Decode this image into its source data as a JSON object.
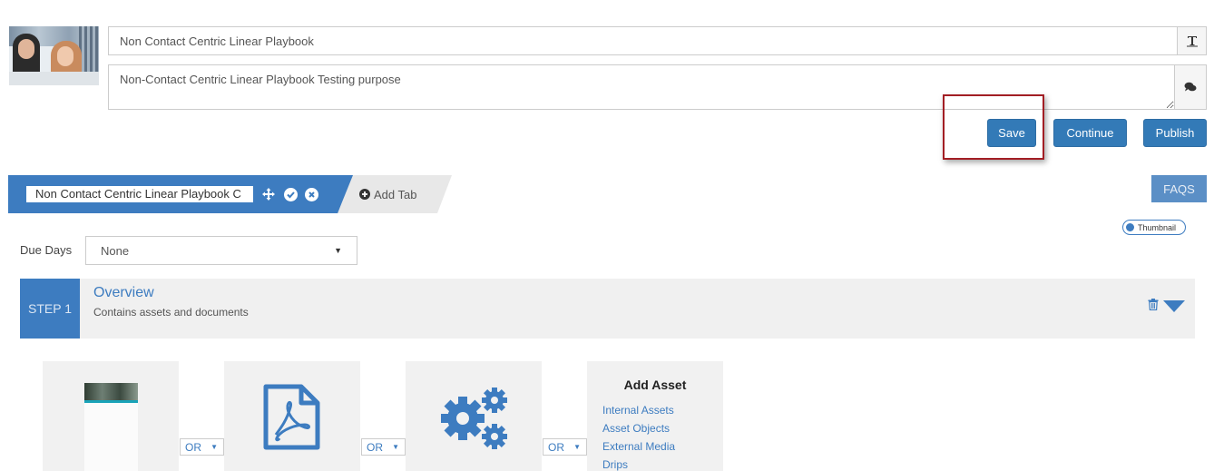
{
  "header": {
    "title_value": "Non Contact Centric Linear Playbook",
    "description_value": "Non-Contact Centric Linear Playbook Testing purpose"
  },
  "buttons": {
    "save": "Save",
    "continue": "Continue",
    "publish": "Publish"
  },
  "tabs": {
    "active_tab_value": "Non Contact Centric Linear Playbook C",
    "add_tab": "Add Tab",
    "faqs": "FAQS"
  },
  "toggle": {
    "label": "Thumbnail"
  },
  "due_days": {
    "label": "Due Days",
    "selected": "None"
  },
  "step": {
    "badge": "STEP 1",
    "title": "Overview",
    "subtitle": "Contains assets and documents"
  },
  "assets": {
    "or_label": "OR",
    "add_asset_title": "Add Asset",
    "links": [
      "Internal Assets",
      "Asset Objects",
      "External Media",
      "Drips"
    ]
  },
  "colors": {
    "primary": "#337ab7",
    "highlight": "#a21e24",
    "tab_blue": "#3d7cc0"
  },
  "icons": [
    "text-format-icon",
    "comment-icon",
    "move-icon",
    "check-circle-icon",
    "close-circle-icon",
    "plus-circle-icon",
    "trash-icon",
    "caret-down-icon",
    "pdf-file-icon",
    "gears-icon"
  ]
}
